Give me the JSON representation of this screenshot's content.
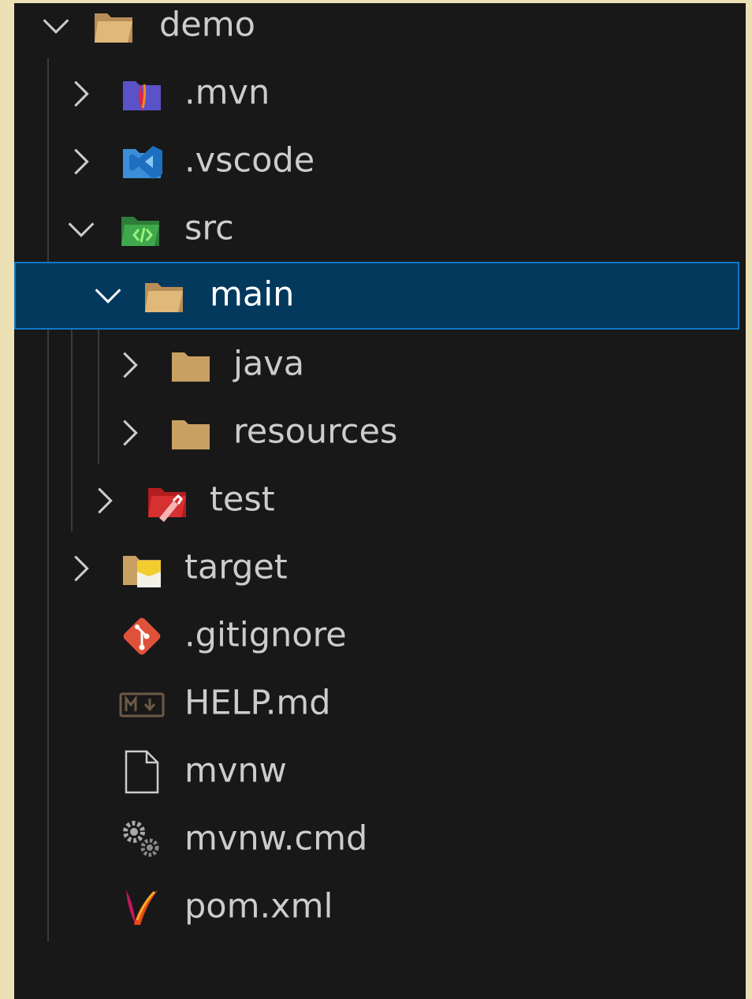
{
  "explorer": {
    "items": [
      {
        "label": "demo",
        "icon": "folder-open-icon",
        "expanded": true
      },
      {
        "label": ".mvn",
        "icon": "maven-folder-icon",
        "expanded": false
      },
      {
        "label": ".vscode",
        "icon": "vscode-folder-icon",
        "expanded": false
      },
      {
        "label": "src",
        "icon": "src-folder-icon",
        "expanded": true
      },
      {
        "label": "main",
        "icon": "folder-open-icon",
        "expanded": true,
        "selected": true
      },
      {
        "label": "java",
        "icon": "folder-icon",
        "expanded": false
      },
      {
        "label": "resources",
        "icon": "folder-icon",
        "expanded": false
      },
      {
        "label": "test",
        "icon": "test-folder-icon",
        "expanded": false
      },
      {
        "label": "target",
        "icon": "target-folder-icon",
        "expanded": false
      },
      {
        "label": ".gitignore",
        "icon": "git-icon"
      },
      {
        "label": "HELP.md",
        "icon": "markdown-icon"
      },
      {
        "label": "mvnw",
        "icon": "file-icon"
      },
      {
        "label": "mvnw.cmd",
        "icon": "gears-icon"
      },
      {
        "label": "pom.xml",
        "icon": "maven-feather-icon"
      }
    ]
  },
  "colors": {
    "background": "#181818",
    "selection": "#04395e",
    "selection_border": "#0e78c8",
    "text": "#cccccc",
    "folder": "#c8a062"
  }
}
